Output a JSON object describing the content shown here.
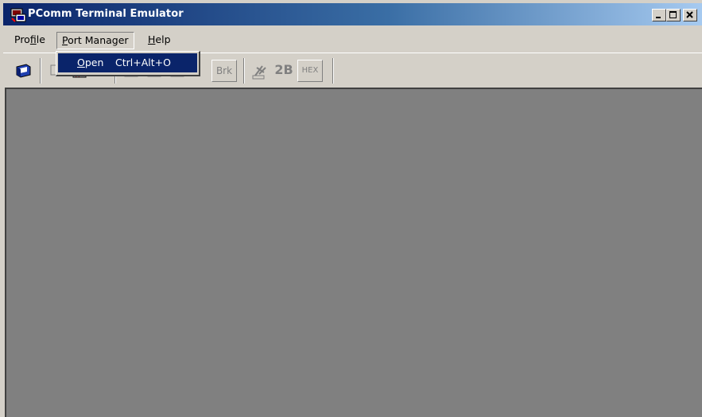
{
  "window": {
    "title": "PComm Terminal Emulator",
    "icon": "pcomm-app-icon",
    "colors": {
      "face": "#d4d0c8",
      "title_start": "#0a246a",
      "title_end": "#a6caf0",
      "client": "#808080",
      "highlight": "#0a246a"
    }
  },
  "menubar": {
    "items": [
      {
        "pre": "Pro",
        "accel": "f",
        "post": "ile",
        "name": "Profile"
      },
      {
        "pre": "",
        "accel": "P",
        "post": "ort Manager",
        "name": "Port Manager",
        "open": true
      },
      {
        "pre": "",
        "accel": "H",
        "post": "elp",
        "name": "Help"
      }
    ]
  },
  "port_manager_menu": {
    "items": [
      {
        "accel": "O",
        "rest": "pen",
        "shortcut": "Ctrl+Alt+O",
        "highlighted": true
      }
    ]
  },
  "toolbar": {
    "buttons": [
      {
        "icon": "open-profile-icon"
      },
      {
        "icon": "connect-icon"
      },
      {
        "icon": "port-settings-icon"
      },
      {
        "icon": "terminal-icon"
      },
      {
        "icon": "transfer-icon"
      },
      {
        "icon": "dtr-icon"
      },
      {
        "label": "Brk",
        "icon": "break-icon"
      },
      {
        "icon": "monitor-icon"
      },
      {
        "label": "2B",
        "icon": "two-byte-icon"
      },
      {
        "label": "HEX",
        "icon": "hex-icon"
      }
    ]
  }
}
